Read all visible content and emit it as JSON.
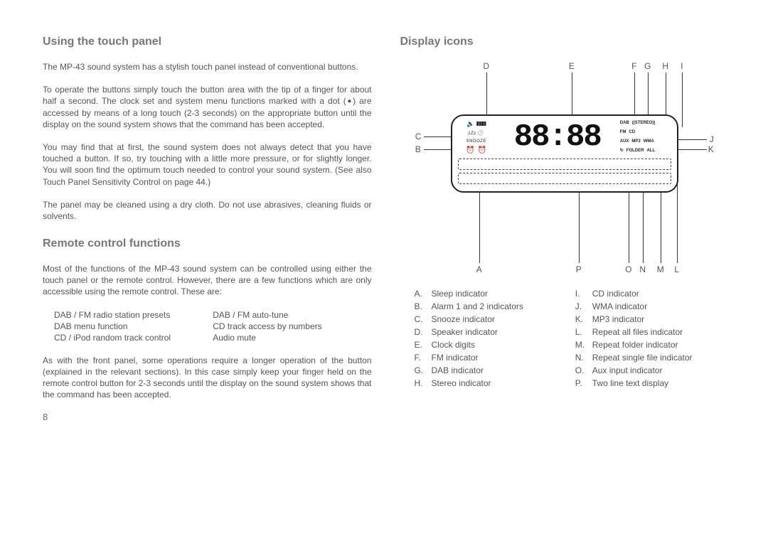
{
  "left": {
    "heading1": "Using the touch panel",
    "p1": "The MP-43 sound system has a stylish touch panel instead of conventional buttons.",
    "p2a": "To operate the buttons simply touch the button area with the tip of a finger for about half a second. The clock set and system menu functions marked with a dot (",
    "p2dot": "●",
    "p2b": ") are accessed by means of a long touch (2-3 seconds) on the appropriate button until the display on the sound system shows that the command has been accepted.",
    "p3": "You may find that at first, the sound system does not always detect that you have touched a button. If so, try touching with a little more pressure, or for slightly longer. You will soon find the optimum touch needed to control your sound system. (See also Touch Panel Sensitivity Control on page 44.)",
    "p4": "The panel may be cleaned using a dry cloth. Do not use abrasives, cleaning fluids or solvents.",
    "heading2": "Remote control functions",
    "p5": "Most of the functions of the MP-43 sound system can be controlled using either the touch panel or the remote control. However, there are a few functions which are only accessible using the remote control. These are:",
    "table": [
      [
        "DAB / FM radio station presets",
        "DAB / FM auto-tune"
      ],
      [
        "DAB menu function",
        "CD track access by numbers"
      ],
      [
        "CD / iPod random track control",
        "Audio mute"
      ]
    ],
    "p6": "As with the front panel, some operations require a longer operation of the button (explained in the relevant sections). In this case simply keep your finger held on the remote control button for 2-3 seconds until the display on the sound system shows that the command has been accepted.",
    "page_number": "8"
  },
  "right": {
    "heading": "Display icons",
    "callouts": {
      "D": "D",
      "E": "E",
      "F": "F",
      "G": "G",
      "H": "H",
      "I": "I",
      "C": "C",
      "B": "B",
      "J": "J",
      "K": "K",
      "A": "A",
      "P": "P",
      "O": "O",
      "N": "N",
      "M": "M",
      "L": "L"
    },
    "screen": {
      "digits": "88:88",
      "snooze": "SNOOZE",
      "sleep": "zZz",
      "speaker": "🔈",
      "alarm": "⏰",
      "r1": [
        "DAB",
        "((STEREO))"
      ],
      "r2": [
        "FM",
        "CD"
      ],
      "r3": [
        "AUX",
        "MP3",
        "WMA"
      ],
      "r4": [
        "↻",
        "FOLDER",
        "ALL"
      ]
    },
    "legend": [
      {
        "letter": "A.",
        "text": "Sleep indicator"
      },
      {
        "letter": "B.",
        "text": "Alarm 1 and 2 indicators"
      },
      {
        "letter": "C.",
        "text": "Snooze indicator"
      },
      {
        "letter": "D.",
        "text": "Speaker indicator"
      },
      {
        "letter": "E.",
        "text": "Clock digits"
      },
      {
        "letter": "F.",
        "text": "FM indicator"
      },
      {
        "letter": "G.",
        "text": "DAB indicator"
      },
      {
        "letter": "H.",
        "text": "Stereo indicator"
      },
      {
        "letter": "I.",
        "text": "CD indicator"
      },
      {
        "letter": "J.",
        "text": "WMA indicator"
      },
      {
        "letter": "K.",
        "text": "MP3 indicator"
      },
      {
        "letter": "L.",
        "text": "Repeat all files indicator"
      },
      {
        "letter": "M.",
        "text": "Repeat folder indicator"
      },
      {
        "letter": "N.",
        "text": "Repeat single file indicator"
      },
      {
        "letter": "O.",
        "text": "Aux input indicator"
      },
      {
        "letter": "P.",
        "text": "Two line text display"
      }
    ]
  }
}
